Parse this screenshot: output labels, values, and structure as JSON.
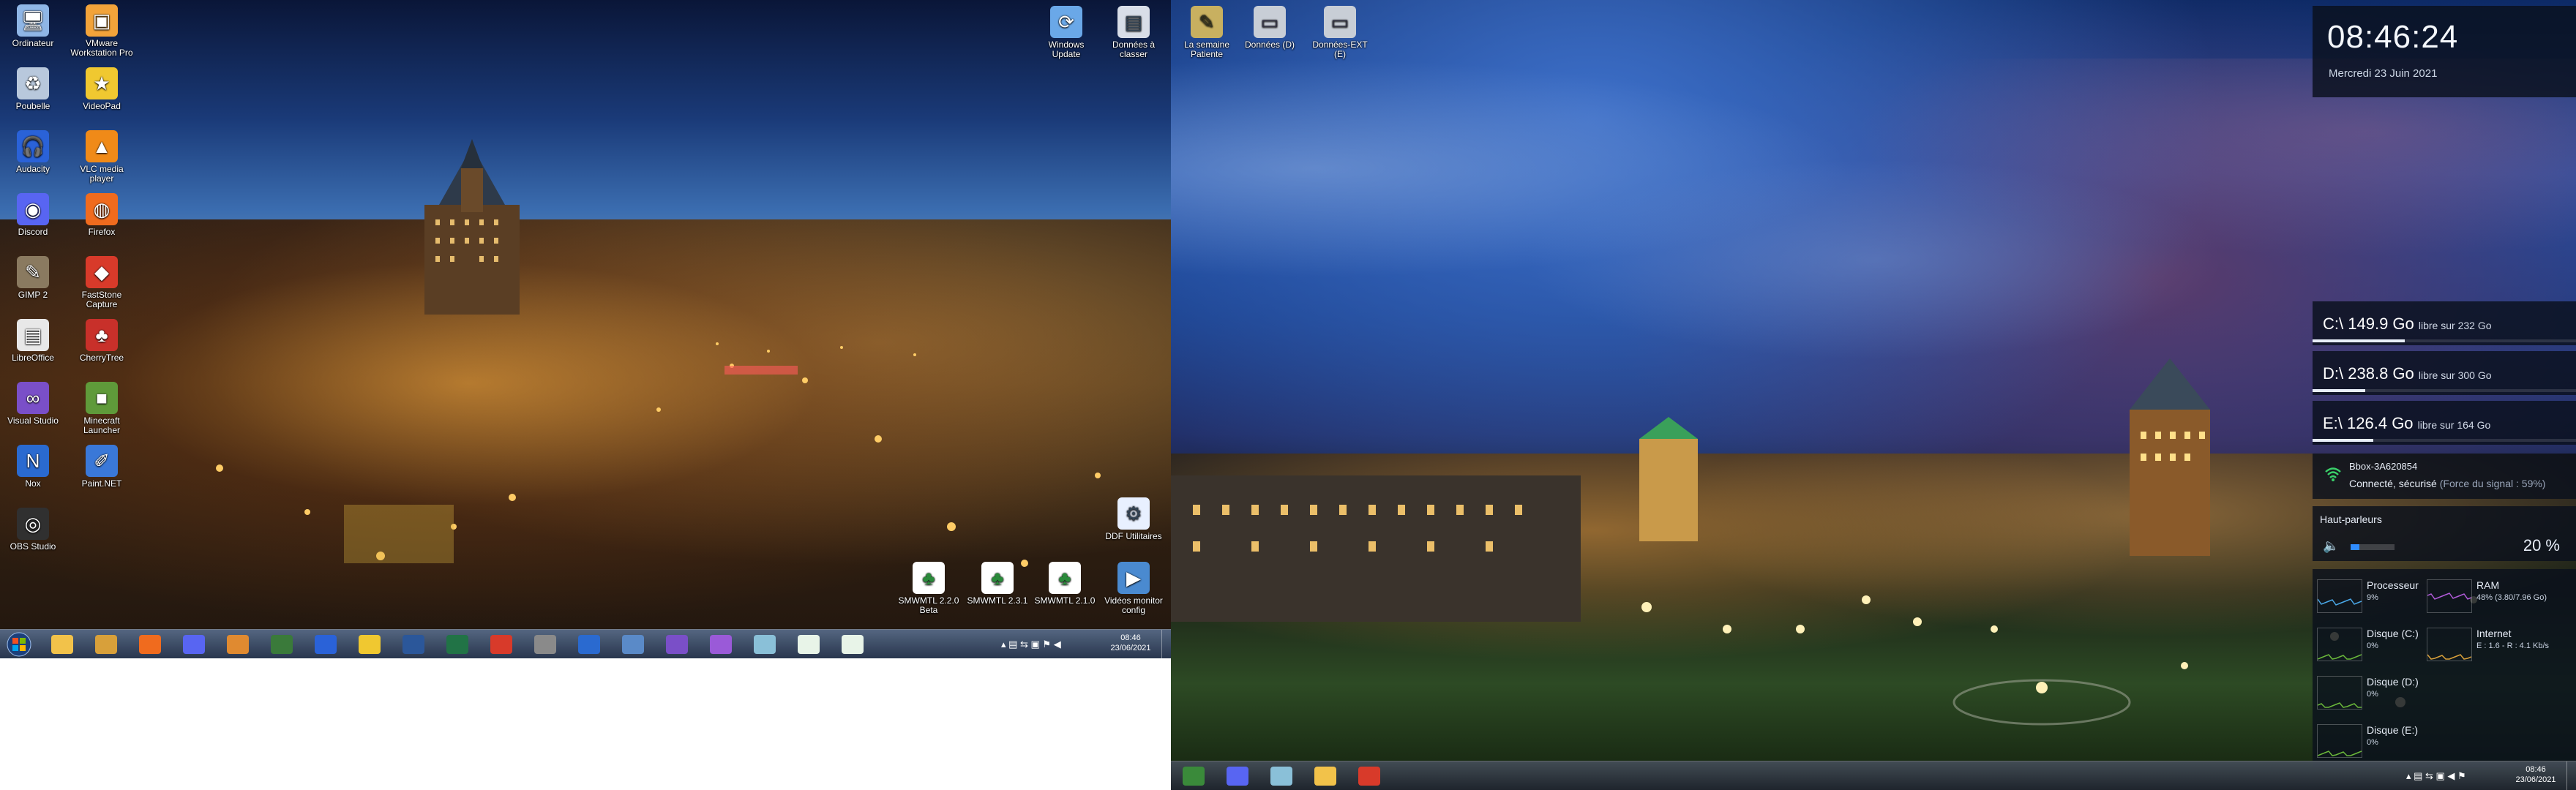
{
  "monitor1": {
    "desktop_icons": [
      {
        "label": "Ordinateur",
        "icon": "computer-icon",
        "color": "#8fb6e6"
      },
      {
        "label": "VMware Workstation Pro",
        "icon": "vmware-icon",
        "color": "#f2a33a"
      },
      {
        "label": "Poubelle",
        "icon": "recycle-bin-icon",
        "color": "#b8c8dc"
      },
      {
        "label": "VideoPad",
        "icon": "videopad-icon",
        "color": "#f0c830"
      },
      {
        "label": "Audacity",
        "icon": "audacity-icon",
        "color": "#2a62d8"
      },
      {
        "label": "VLC media player",
        "icon": "vlc-icon",
        "color": "#f08a18"
      },
      {
        "label": "Discord",
        "icon": "discord-icon",
        "color": "#5865f2"
      },
      {
        "label": "Firefox",
        "icon": "firefox-icon",
        "color": "#f06b1e"
      },
      {
        "label": "GIMP 2",
        "icon": "gimp-icon",
        "color": "#8a7a60"
      },
      {
        "label": "FastStone Capture",
        "icon": "faststone-icon",
        "color": "#d83a2a"
      },
      {
        "label": "LibreOffice",
        "icon": "libreoffice-icon",
        "color": "#e8e8e8"
      },
      {
        "label": "CherryTree",
        "icon": "cherrytree-icon",
        "color": "#c8302a"
      },
      {
        "label": "Visual Studio",
        "icon": "visual-studio-icon",
        "color": "#7a4fc8"
      },
      {
        "label": "Minecraft Launcher",
        "icon": "minecraft-icon",
        "color": "#5f9a3a"
      },
      {
        "label": "Nox",
        "icon": "nox-icon",
        "color": "#2a6ad0"
      },
      {
        "label": "Paint.NET",
        "icon": "paintnet-icon",
        "color": "#3a78d8"
      },
      {
        "label": "OBS Studio",
        "icon": "obs-icon",
        "color": "#303030"
      }
    ],
    "top_right_icons": [
      {
        "label": "Windows Update",
        "icon": "windows-update-icon",
        "color": "#6aa8e8"
      },
      {
        "label": "Données à classer",
        "icon": "folder-data-icon",
        "color": "#d8dee8"
      }
    ],
    "bottom_icons": [
      {
        "label": "SMWMTL 2.2.0 Beta",
        "icon": "smwmtl-icon",
        "color": "#ffffff"
      },
      {
        "label": "SMWMTL 2.3.1",
        "icon": "smwmtl-icon",
        "color": "#ffffff"
      },
      {
        "label": "SMWMTL 2.1.0",
        "icon": "smwmtl-icon",
        "color": "#ffffff"
      },
      {
        "label": "DDF Utilitaires",
        "icon": "utility-icon",
        "color": "#e8f0ff"
      },
      {
        "label": "Vidéos monitor config",
        "icon": "video-icon",
        "color": "#4a8ad0"
      }
    ],
    "taskbar": {
      "clock_time": "08:46",
      "clock_date": "23/06/2021",
      "apps": [
        "explorer",
        "library",
        "firefox",
        "discord",
        "media-player",
        "steam",
        "audacity",
        "videopad",
        "word",
        "excel",
        "faststone",
        "system-tool",
        "nox",
        "virtual-box",
        "visual-studio",
        "vs-preview",
        "notepad",
        "smwmtl",
        "smwmtl-2"
      ]
    }
  },
  "monitor2": {
    "desktop_icons": [
      {
        "label": "La semaine Patiente",
        "icon": "calendar-doc-icon",
        "color": "#c8b060"
      },
      {
        "label": "Données (D)",
        "icon": "drive-d-icon",
        "color": "#c8ced6"
      },
      {
        "label": "Données-EXT (E)",
        "icon": "drive-e-icon",
        "color": "#c8ced6"
      }
    ],
    "clock_widget": {
      "time": "08:46:24",
      "date": "Mercredi 23 Juin 2021"
    },
    "drives": [
      {
        "letter": "C:\\",
        "free": "149.9 Go",
        "total_text": "libre sur 232 Go",
        "used_fraction": 0.35
      },
      {
        "letter": "D:\\",
        "free": "238.8 Go",
        "total_text": "libre sur 300 Go",
        "used_fraction": 0.2
      },
      {
        "letter": "E:\\",
        "free": "126.4 Go",
        "total_text": "libre sur 164 Go",
        "used_fraction": 0.23
      }
    ],
    "wifi": {
      "name": "Bbox-3A620854",
      "status": "Connecté, sécurisé",
      "signal": "(Force du signal : 59%)"
    },
    "audio": {
      "title": "Haut-parleurs",
      "percent": "20 %",
      "level": 0.2
    },
    "perf": [
      {
        "name": "Processeur",
        "value": "9%",
        "color": "#4aa8e8"
      },
      {
        "name": "RAM",
        "value": "48% (3.80/7.96 Go)",
        "color": "#b05ad8"
      },
      {
        "name": "Disque (C:)",
        "value": "0%",
        "color": "#6ab83a"
      },
      {
        "name": "Internet",
        "value": "E : 1.6 - R : 4.1 Kb/s",
        "color": "#d8a03a"
      },
      {
        "name": "Disque (D:)",
        "value": "0%",
        "color": "#6ab83a"
      },
      {
        "name": "Disque (E:)",
        "value": "0%",
        "color": "#6ab83a"
      }
    ],
    "taskbar": {
      "clock_time": "08:46",
      "clock_date": "23/06/2021",
      "apps": [
        "nox",
        "discord",
        "notepad",
        "explorer",
        "faststone"
      ]
    }
  }
}
